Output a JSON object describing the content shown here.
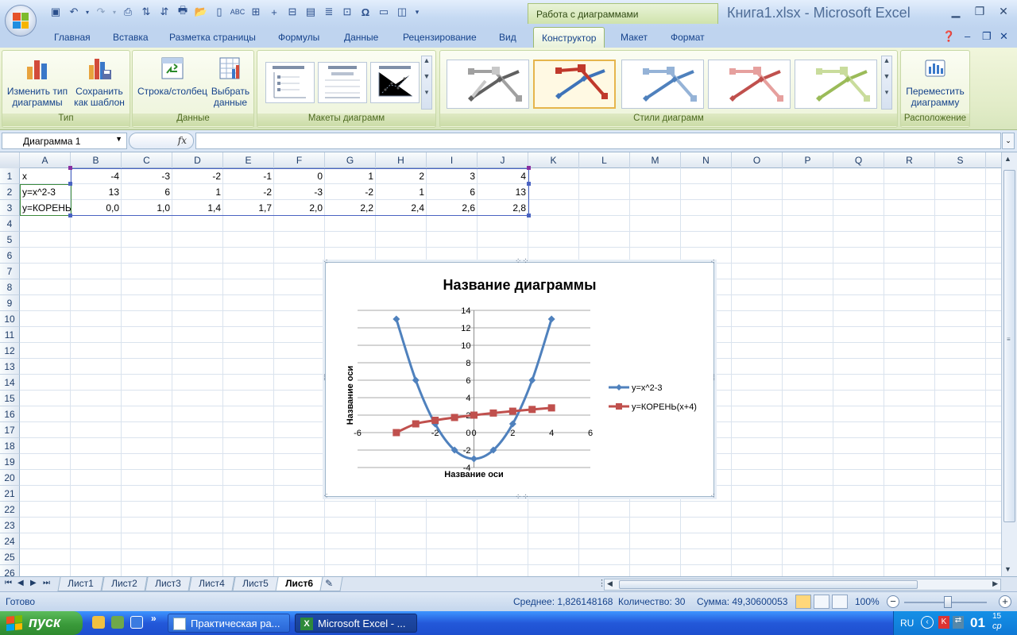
{
  "window": {
    "title": "Книга1.xlsx - Microsoft Excel",
    "context_tab": "Работа с диаграммами"
  },
  "ribbon_tabs": [
    "Главная",
    "Вставка",
    "Разметка страницы",
    "Формулы",
    "Данные",
    "Рецензирование",
    "Вид",
    "Конструктор",
    "Макет",
    "Формат"
  ],
  "ribbon": {
    "type_group": {
      "label": "Тип",
      "btn1": "Изменить тип диаграммы",
      "btn2": "Сохранить как шаблон"
    },
    "data_group": {
      "label": "Данные",
      "btn1": "Строка/столбец",
      "btn2": "Выбрать данные"
    },
    "layouts_group": {
      "label": "Макеты диаграмм"
    },
    "styles_group": {
      "label": "Стили диаграмм"
    },
    "location_group": {
      "label": "Расположение",
      "btn1": "Переместить диаграмму"
    }
  },
  "formula_bar": {
    "name_box": "Диаграмма 1",
    "fx": "fx",
    "formula": ""
  },
  "columns": [
    "A",
    "B",
    "C",
    "D",
    "E",
    "F",
    "G",
    "H",
    "I",
    "J",
    "K",
    "L",
    "M",
    "N",
    "O",
    "P",
    "Q",
    "R",
    "S"
  ],
  "rows": [
    "1",
    "2",
    "3",
    "4",
    "5",
    "6",
    "7",
    "8",
    "9",
    "10",
    "11",
    "12",
    "13",
    "14",
    "15",
    "16",
    "17",
    "18",
    "19",
    "20",
    "21",
    "22",
    "23",
    "24",
    "25",
    "26"
  ],
  "sheet": {
    "row1": [
      "x",
      "-4",
      "-3",
      "-2",
      "-1",
      "0",
      "1",
      "2",
      "3",
      "4"
    ],
    "row2": [
      "y=x^2-3",
      "13",
      "6",
      "1",
      "-2",
      "-3",
      "-2",
      "1",
      "6",
      "13"
    ],
    "row3": [
      "y=КОРЕНЬ(x+4)",
      "0,0",
      "1,0",
      "1,4",
      "1,7",
      "2,0",
      "2,2",
      "2,4",
      "2,6",
      "2,8"
    ]
  },
  "chart_data": {
    "type": "scatter",
    "title": "Название диаграммы",
    "xlabel": "Название оси",
    "ylabel": "Название оси",
    "xlim": [
      -6,
      6
    ],
    "ylim": [
      -4,
      14
    ],
    "xticks": [
      "-6",
      "-4",
      "-2",
      "0",
      "2",
      "4",
      "6"
    ],
    "yticks": [
      "-4",
      "-2",
      "0",
      "2",
      "4",
      "6",
      "8",
      "10",
      "12",
      "14"
    ],
    "grid": "horizontal",
    "legend": "right",
    "series": [
      {
        "name": "y=x^2-3",
        "color": "#4f81bd",
        "marker": "diamond",
        "x": [
          -4,
          -3,
          -2,
          -1,
          0,
          1,
          2,
          3,
          4
        ],
        "y": [
          13,
          6,
          1,
          -2,
          -3,
          -2,
          1,
          6,
          13
        ]
      },
      {
        "name": "y=КОРЕНЬ(x+4)",
        "color": "#c0504d",
        "marker": "square",
        "x": [
          -4,
          -3,
          -2,
          -1,
          0,
          1,
          2,
          3,
          4
        ],
        "y": [
          0,
          1,
          1.41,
          1.73,
          2,
          2.24,
          2.45,
          2.65,
          2.83
        ]
      }
    ]
  },
  "sheet_tabs": [
    "Лист1",
    "Лист2",
    "Лист3",
    "Лист4",
    "Лист5",
    "Лист6"
  ],
  "active_sheet": "Лист6",
  "status": {
    "ready": "Готово",
    "average": "Среднее: 1,826148168",
    "count": "Количество: 30",
    "sum": "Сумма: 49,30600053",
    "zoom": "100%"
  },
  "taskbar": {
    "start": "пуск",
    "tasks": [
      "Практическая ра...",
      "Microsoft Excel - ..."
    ],
    "lang": "RU",
    "time_hour": "01",
    "time_min": "15",
    "day": "ср"
  }
}
